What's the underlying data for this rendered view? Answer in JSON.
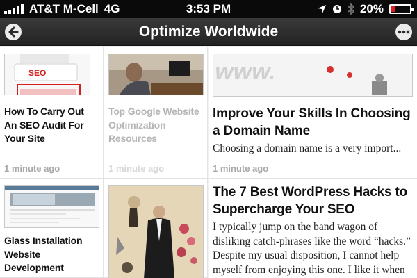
{
  "status_bar": {
    "carrier": "AT&T M-Cell",
    "network": "4G",
    "time": "3:53 PM",
    "battery": "20%",
    "battery_fill": 0.2
  },
  "nav": {
    "title": "Optimize Worldwide"
  },
  "articles": [
    {
      "title": "How To Carry Out An SEO Audit For Your Site",
      "time": "1 minute ago",
      "thumb_text": "SEO"
    },
    {
      "title": "Top Google Website Optimization Resources",
      "time": "1 minute ago"
    },
    {
      "title": "Improve Your Skills In Choosing a Domain Name",
      "snippet": "Choosing a domain name is a very import...",
      "time": "1 minute ago"
    },
    {
      "title": "Glass Installation Website Development"
    },
    {
      "title": "The 7 Best WordPress Hacks to Supercharge Your SEO",
      "snippet": "I typically jump on the band wagon of disliking catch-phrases like the word “hacks.” Despite my usual disposition, I cannot help myself from enjoying this one. I like it when programmers create a pretty cute"
    }
  ],
  "colors": {
    "status_bar": "#0a0a0a",
    "nav_bar": "#2d2d2d",
    "read_text": "#b5b5b5",
    "battery_low": "#e02020"
  }
}
